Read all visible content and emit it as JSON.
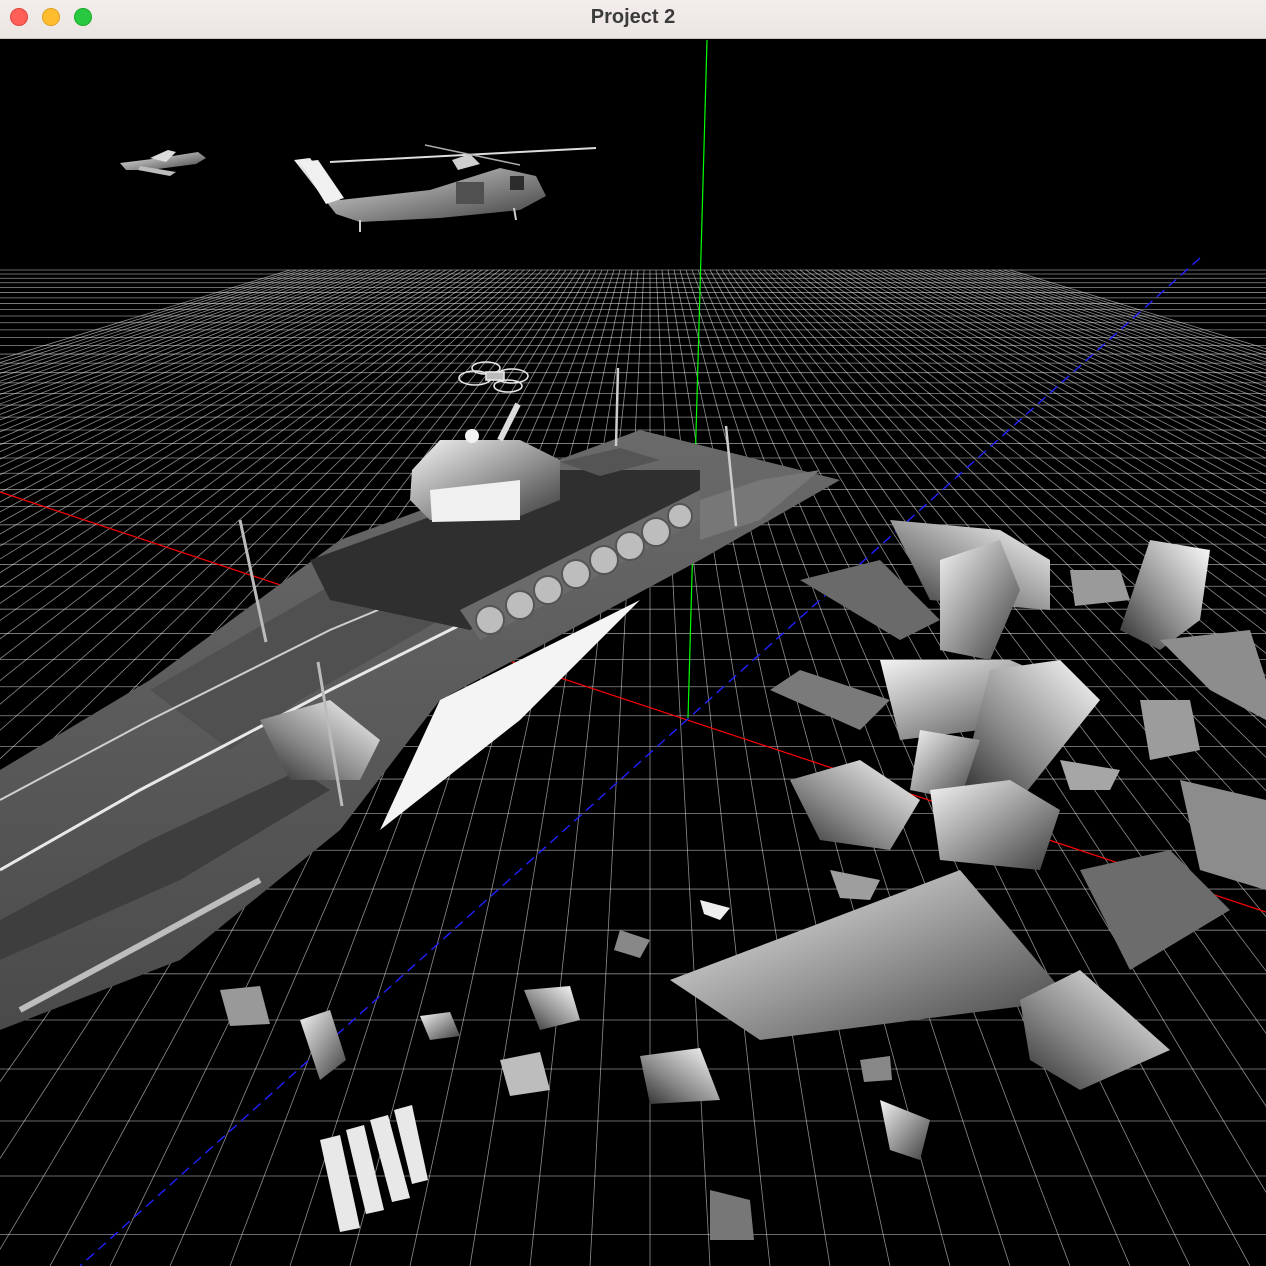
{
  "window": {
    "title": "Project 2",
    "controls": [
      "close",
      "minimize",
      "zoom"
    ]
  },
  "scene": {
    "background": "#000000",
    "grid_color": "#ffffff",
    "axes": {
      "x_color": "#ff0000",
      "y_color": "#00ff00",
      "z_color": "#0000ff"
    },
    "objects": [
      "airplane",
      "helicopter",
      "drone",
      "tank",
      "aircraft-carrier",
      "debris"
    ],
    "colors": {
      "model_light": "#e8e8e8",
      "model_mid": "#8a8a8a",
      "model_dark": "#3a3a3a"
    }
  }
}
